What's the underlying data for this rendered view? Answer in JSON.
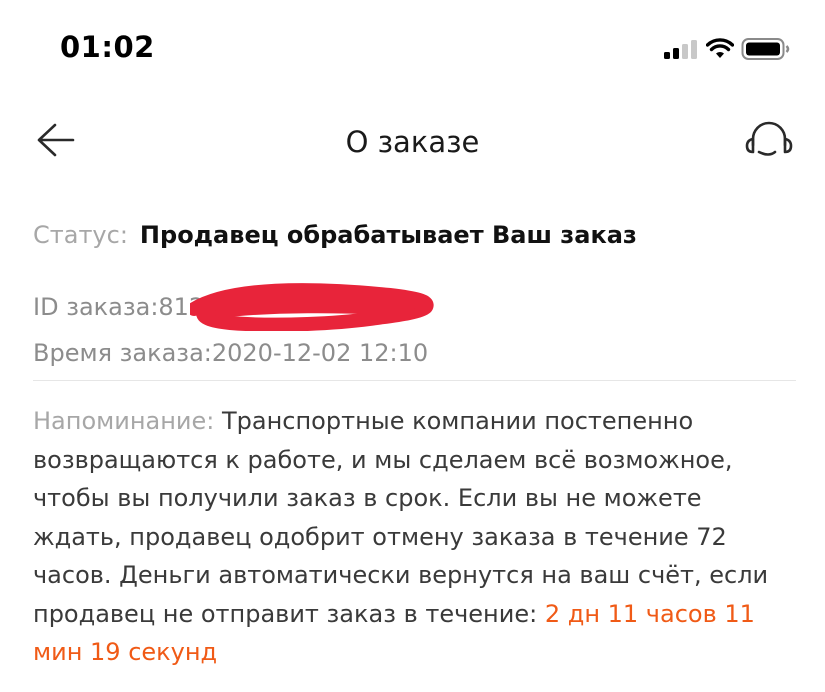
{
  "status_bar": {
    "time": "01:02",
    "icons": [
      "cellular-signal-icon",
      "wifi-icon",
      "battery-icon"
    ]
  },
  "nav": {
    "title": "О заказе",
    "back_icon": "arrow-left-icon",
    "support_icon": "headset-icon"
  },
  "order": {
    "status_label": "Статус:",
    "status_value": "Продавец обрабатывает Ваш заказ",
    "id_text": "ID заказа:812",
    "time_text": "Время заказа:2020-12-02 12:10"
  },
  "reminder": {
    "label": "Напоминание:",
    "text": " Транспортные компании постепенно возвращаются к работе, и мы сделаем всё возможное, чтобы вы получили заказ в срок. Если вы не можете ждать, продавец одобрит отмену заказа в течение 72 часов. Деньги автоматически вернутся на ваш счёт, если продавец не отправит заказ в течение: ",
    "countdown": "2 дн 11 часов 11 мин 19 секунд"
  },
  "colors": {
    "accent": "#f05a16",
    "label_gray": "#a7a7a7",
    "redaction": "#e8243a"
  }
}
